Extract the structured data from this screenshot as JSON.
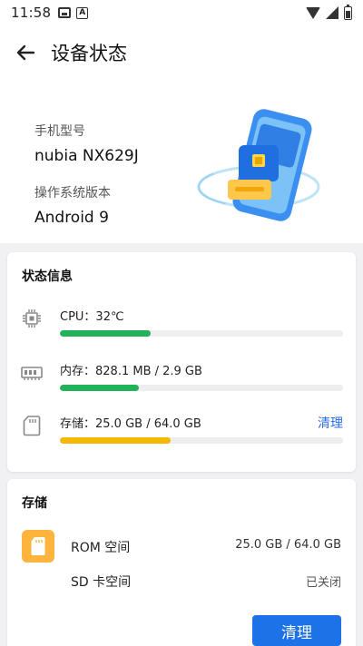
{
  "statusbar": {
    "time": "11:58"
  },
  "header": {
    "title": "设备状态"
  },
  "device": {
    "model_label": "手机型号",
    "model_value": "nubia NX629J",
    "os_label": "操作系统版本",
    "os_value": "Android 9"
  },
  "status_card": {
    "title": "状态信息",
    "cpu": {
      "text": "CPU：32℃",
      "progress": 0.32,
      "color": "#22b35a"
    },
    "memory": {
      "text": "内存：828.1 MB / 2.9 GB",
      "progress": 0.28,
      "color": "#22b35a"
    },
    "storage": {
      "text": "存储：25.0 GB / 64.0 GB",
      "progress": 0.39,
      "color": "#f5b800",
      "action": "清理"
    }
  },
  "storage_card": {
    "title": "存储",
    "rom": {
      "label": "ROM 空间",
      "value": "25.0 GB / 64.0 GB"
    },
    "sd": {
      "label": "SD 卡空间",
      "value": "已关闭"
    },
    "clean_button": "清理"
  },
  "colors": {
    "accent": "#1e72e8",
    "link": "#2b6de8",
    "rom_icon": "#fdb43c"
  },
  "icons": {
    "back": "back-arrow-icon",
    "cpu": "cpu-chip-icon",
    "memory": "memory-ram-icon",
    "storage": "sd-card-icon",
    "rom": "rom-card-icon"
  }
}
